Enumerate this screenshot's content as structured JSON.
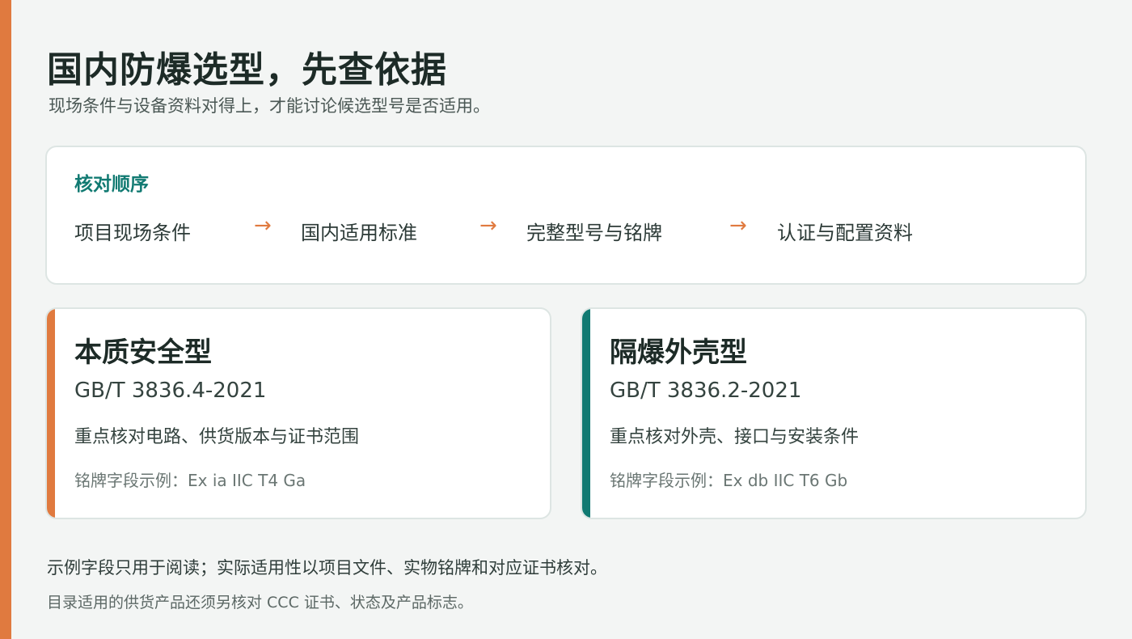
{
  "page": {
    "title": "国内防爆选型，先查依据",
    "subtitle": "现场条件与设备资料对得上，才能讨论候选型号是否适用。"
  },
  "colors": {
    "accent_orange": "#e07a3f",
    "accent_teal": "#117a72",
    "background": "#f3f5f4"
  },
  "check_order": {
    "heading": "核对顺序",
    "steps": [
      "项目现场条件",
      "国内适用标准",
      "完整型号与铭牌",
      "认证与配置资料"
    ],
    "arrow": "→"
  },
  "types": [
    {
      "title": "本质安全型",
      "standard": "GB/T 3836.4-2021",
      "focus": "重点核对电路、供货版本与证书范围",
      "nameplate": "铭牌字段示例：Ex ia IIC T4 Ga"
    },
    {
      "title": "隔爆外壳型",
      "standard": "GB/T 3836.2-2021",
      "focus": "重点核对外壳、接口与安装条件",
      "nameplate": "铭牌字段示例：Ex db IIC T6 Gb"
    }
  ],
  "notes": {
    "primary": "示例字段只用于阅读；实际适用性以项目文件、实物铭牌和对应证书核对。",
    "secondary": "目录适用的供货产品还须另核对 CCC 证书、状态及产品标志。"
  }
}
